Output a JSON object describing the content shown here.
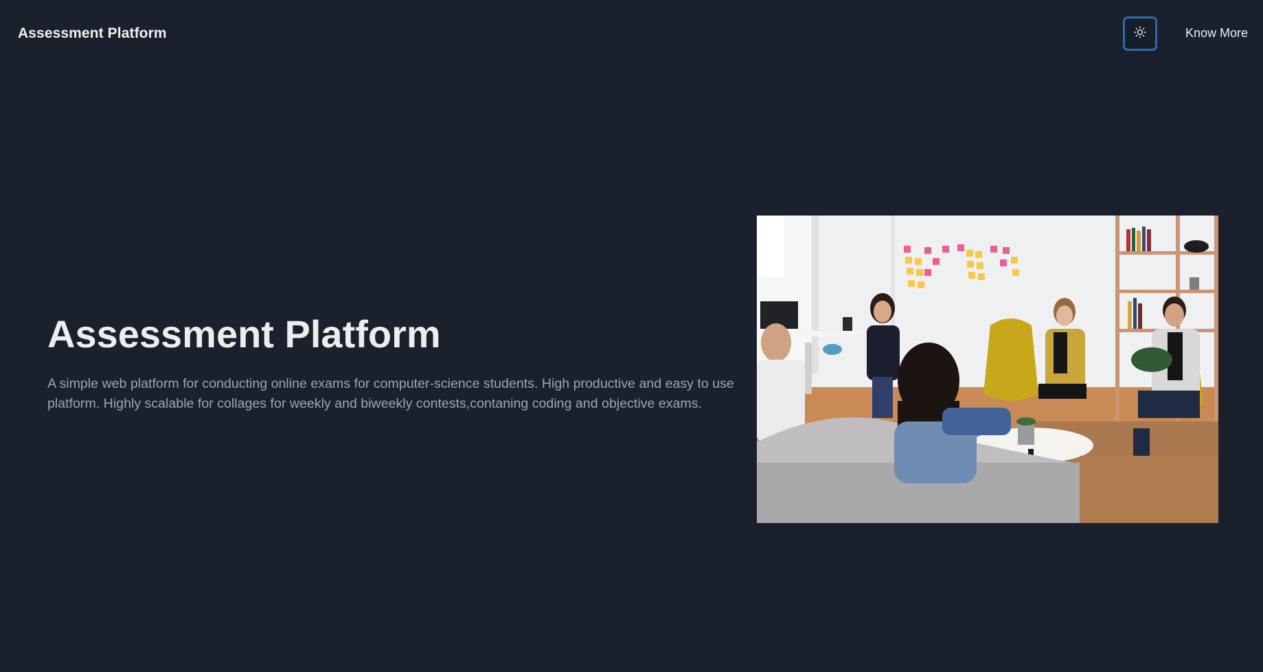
{
  "header": {
    "brand": "Assessment Platform",
    "theme_toggle_icon": "sun-icon",
    "know_more_label": "Know More"
  },
  "hero": {
    "title": "Assessment Platform",
    "description": "A simple web platform for conducting online exams for computer-science students. High productive and easy to use platform. Highly scalable for collages for weekly and biweekly contests,contaning coding and objective exams.",
    "image_subject": "team-meeting-photo"
  },
  "colors": {
    "background": "#1a202c",
    "toggle_border": "#2b6cb0",
    "title": "#ededed",
    "description": "#a0a5ae"
  }
}
